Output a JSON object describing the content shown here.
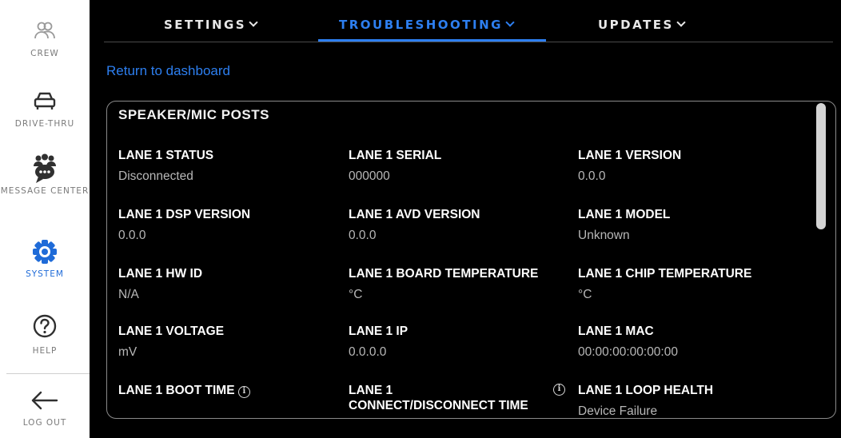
{
  "sidebar": {
    "items": [
      {
        "label": "CREW",
        "icon": "crew-icon"
      },
      {
        "label": "DRIVE-THRU",
        "icon": "car-icon"
      },
      {
        "label": "MESSAGE CENTER",
        "icon": "message-center-icon"
      },
      {
        "label": "SYSTEM",
        "icon": "gear-icon",
        "active": true
      },
      {
        "label": "HELP",
        "icon": "help-icon"
      },
      {
        "label": "LOG OUT",
        "icon": "arrow-left-icon"
      }
    ]
  },
  "tabs": [
    {
      "label": "SETTINGS"
    },
    {
      "label": "TROUBLESHOOTING",
      "active": true
    },
    {
      "label": "UPDATES"
    }
  ],
  "return_link": "Return to dashboard",
  "panel": {
    "title": "SPEAKER/MIC POSTS",
    "fields": [
      {
        "label": "LANE 1 STATUS",
        "value": "Disconnected"
      },
      {
        "label": "LANE 1 SERIAL",
        "value": "000000"
      },
      {
        "label": "LANE 1 VERSION",
        "value": "0.0.0"
      },
      {
        "label": "LANE 1 DSP VERSION",
        "value": "0.0.0"
      },
      {
        "label": "LANE 1 AVD VERSION",
        "value": "0.0.0"
      },
      {
        "label": "LANE 1 MODEL",
        "value": "Unknown"
      },
      {
        "label": "LANE 1 HW ID",
        "value": "N/A"
      },
      {
        "label": "LANE 1 BOARD TEMPERATURE",
        "value": "°C"
      },
      {
        "label": "LANE 1 CHIP TEMPERATURE",
        "value": "°C"
      },
      {
        "label": "LANE 1 VOLTAGE",
        "value": "mV"
      },
      {
        "label": "LANE 1 IP",
        "value": "0.0.0.0"
      },
      {
        "label": "LANE 1 MAC",
        "value": "00:00:00:00:00:00"
      },
      {
        "label": "LANE 1 BOOT TIME",
        "value": ""
      },
      {
        "label": "LANE 1",
        "label_line2": "CONNECT/DISCONNECT TIME",
        "value": ""
      },
      {
        "label": "LANE 1 LOOP HEALTH",
        "value": "Device Failure"
      }
    ]
  },
  "colors": {
    "accent": "#2d7ff0",
    "background": "#000000",
    "sidebar": "#ffffff"
  }
}
